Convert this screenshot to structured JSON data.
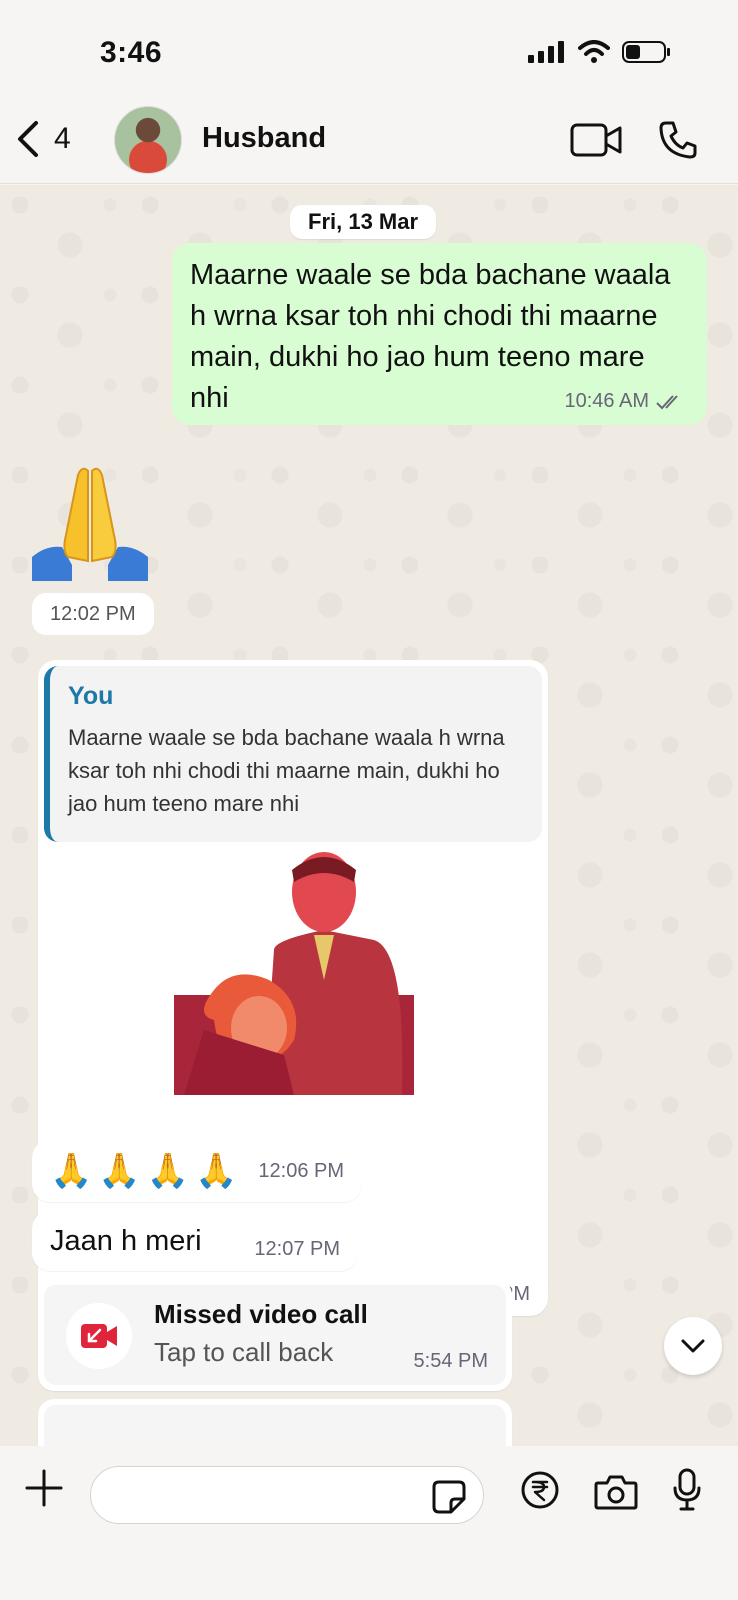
{
  "status_bar": {
    "time": "3:46"
  },
  "header": {
    "back_count": "4",
    "contact_name": "Husband"
  },
  "chat": {
    "date_chip": "Fri, 13 Mar",
    "outgoing_message": {
      "text": "Maarne waale se bda bachane waala h wrna ksar toh nhi chodi thi maarne main, dukhi ho jao hum teeno mare nhi",
      "time": "10:46 AM",
      "status": "read"
    },
    "emoji_message": {
      "emoji": "🙏",
      "time": "12:02 PM"
    },
    "reply_message": {
      "quote_author": "You",
      "quote_text": "Maarne waale se bda bachane waala h wrna ksar toh nhi chodi thi maarne main, dukhi ho jao hum teeno mare nhi",
      "time": "12:06 PM"
    },
    "emoji_row": {
      "emojis": [
        "🙏",
        "🙏",
        "🙏",
        "🙏"
      ],
      "time": "12:06 PM"
    },
    "text_message": {
      "text": "Jaan h meri",
      "time": "12:07 PM"
    },
    "missed_call": {
      "title": "Missed video call",
      "subtitle": "Tap to call back",
      "time": "5:54 PM"
    }
  },
  "composer": {
    "placeholder": ""
  },
  "colors": {
    "outgoing_bubble": "#d9fdd3",
    "quote_accent": "#1d79a8",
    "missed_call_red": "#e0253b"
  }
}
